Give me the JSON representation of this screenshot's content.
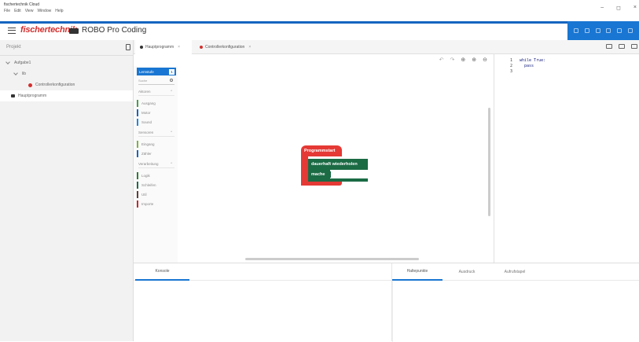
{
  "window": {
    "title": "fischertechnik Cloud",
    "menu": [
      "File",
      "Edit",
      "View",
      "Window",
      "Help"
    ],
    "controls": [
      "–",
      "◻",
      "×"
    ]
  },
  "header": {
    "brand": "fischertechnik",
    "app_name": "ROBO Pro Coding",
    "accent_color": "#1976d2",
    "brand_color": "#d32f2f"
  },
  "project": {
    "title": "Projekt",
    "tree": [
      {
        "label": "Aufgabe1",
        "level": 0,
        "type": "folder"
      },
      {
        "label": "lib",
        "level": 1,
        "type": "folder"
      },
      {
        "label": "Controllerkonfiguration",
        "level": 2,
        "type": "config"
      },
      {
        "label": "Hauptprogramm",
        "level": 0,
        "type": "program"
      }
    ]
  },
  "tabs": [
    {
      "label": "Hauptprogramm",
      "active": true,
      "color": "#333333"
    },
    {
      "label": "Controllerkonfiguration",
      "active": false,
      "color": "#d32f2f"
    }
  ],
  "toolbox": {
    "level_label": "Lernstufe",
    "level_value": "1",
    "search_placeholder": "Suche",
    "categories": [
      {
        "label": "Aktoren",
        "items": [
          {
            "label": "Ausgang",
            "color": "#43a047"
          },
          {
            "label": "Motor",
            "color": "#1565c0"
          },
          {
            "label": "Sound",
            "color": "#1e88e5"
          }
        ]
      },
      {
        "label": "Sensoren",
        "items": [
          {
            "label": "Eingang",
            "color": "#7cb342"
          },
          {
            "label": "Zähler",
            "color": "#1565c0"
          }
        ]
      },
      {
        "label": "Verarbeitung",
        "items": [
          {
            "label": "Logik",
            "color": "#2e7d32"
          },
          {
            "label": "Schleifen",
            "color": "#1b6b45"
          },
          {
            "label": "Util",
            "color": "#5d4037"
          },
          {
            "label": "Importe",
            "color": "#c62828"
          }
        ]
      }
    ]
  },
  "canvas": {
    "tools": [
      "undo-icon",
      "redo-icon",
      "center-icon",
      "zoom-in-icon",
      "zoom-out-icon"
    ],
    "blocks": {
      "start": "Programmstart",
      "loop": "dauerhaft wiederholen",
      "do": "mache"
    }
  },
  "code": {
    "lines": [
      {
        "num": "1",
        "text": "while True:"
      },
      {
        "num": "2",
        "text": "  pass"
      },
      {
        "num": "3",
        "text": ""
      }
    ]
  },
  "console": {
    "tab": "Konsole"
  },
  "debug": {
    "tabs": [
      "Haltepunkte",
      "Ausdruck",
      "Aufrufstapel"
    ]
  }
}
